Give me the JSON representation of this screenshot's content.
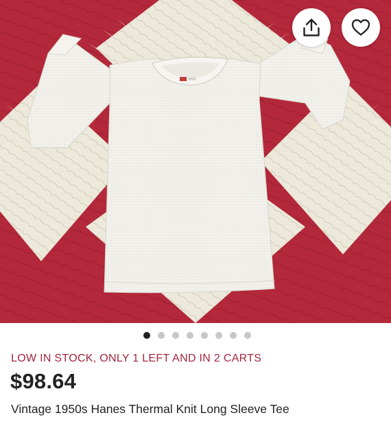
{
  "listing": {
    "stock_status": "LOW IN STOCK, ONLY 1 LEFT AND IN 2 CARTS",
    "price": "$98.64",
    "title": "Vintage 1950s Hanes Thermal Knit Long Sleeve Tee"
  },
  "gallery": {
    "image_count": 8,
    "active_index": 0
  },
  "actions": {
    "share_icon": "share-icon",
    "favorite_icon": "heart-icon"
  },
  "colors": {
    "stock_status": "#a2263d",
    "quilt_red": "#b3283a",
    "quilt_cream": "#ece8da",
    "dot_active": "#222222",
    "dot_inactive": "#c7c7c7"
  }
}
